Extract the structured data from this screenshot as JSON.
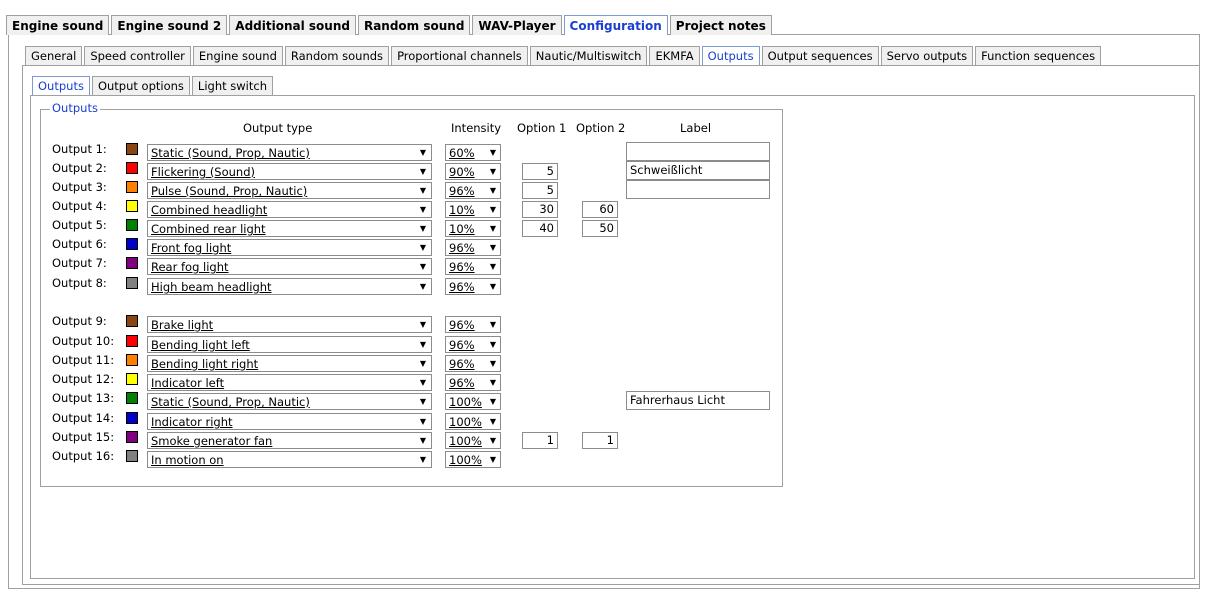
{
  "main_tabs": [
    {
      "label": "Engine sound",
      "active": false
    },
    {
      "label": "Engine sound 2",
      "active": false
    },
    {
      "label": "Additional sound",
      "active": false
    },
    {
      "label": "Random sound",
      "active": false
    },
    {
      "label": "WAV-Player",
      "active": false
    },
    {
      "label": "Configuration",
      "active": true
    },
    {
      "label": "Project notes",
      "active": false
    }
  ],
  "sub_tabs": [
    {
      "label": "General",
      "active": false
    },
    {
      "label": "Speed controller",
      "active": false
    },
    {
      "label": "Engine sound",
      "active": false
    },
    {
      "label": "Random sounds",
      "active": false
    },
    {
      "label": "Proportional channels",
      "active": false
    },
    {
      "label": "Nautic/Multiswitch",
      "active": false
    },
    {
      "label": "EKMFA",
      "active": false
    },
    {
      "label": "Outputs",
      "active": true
    },
    {
      "label": "Output sequences",
      "active": false
    },
    {
      "label": "Servo outputs",
      "active": false
    },
    {
      "label": "Function sequences",
      "active": false
    }
  ],
  "output_tabs": [
    {
      "label": "Outputs",
      "active": true
    },
    {
      "label": "Output options",
      "active": false
    },
    {
      "label": "Light switch",
      "active": false
    }
  ],
  "group_title": "Outputs",
  "headers": {
    "type": "Output type",
    "intensity": "Intensity",
    "option1": "Option 1",
    "option2": "Option 2",
    "label": "Label"
  },
  "arrow_glyph": "▼",
  "outputs": [
    {
      "name": "Output 1:",
      "color": "#8B4513",
      "type": "Static (Sound, Prop, Nautic)",
      "intensity": "60%",
      "opt1": "",
      "opt2": "",
      "label": "",
      "show_label": true
    },
    {
      "name": "Output 2:",
      "color": "#FF0000",
      "type": "Flickering (Sound)",
      "intensity": "90%",
      "opt1": "5",
      "opt2": "",
      "label": "Schweißlicht",
      "show_label": true
    },
    {
      "name": "Output 3:",
      "color": "#FF8000",
      "type": "Pulse (Sound, Prop, Nautic)",
      "intensity": "96%",
      "opt1": "5",
      "opt2": "",
      "label": "",
      "show_label": true
    },
    {
      "name": "Output 4:",
      "color": "#FFFF00",
      "type": "Combined headlight",
      "intensity": "10%",
      "opt1": "30",
      "opt2": "60",
      "label": "",
      "show_label": false
    },
    {
      "name": "Output 5:",
      "color": "#008000",
      "type": "Combined rear light",
      "intensity": "10%",
      "opt1": "40",
      "opt2": "50",
      "label": "",
      "show_label": false
    },
    {
      "name": "Output 6:",
      "color": "#0000CC",
      "type": "Front fog light",
      "intensity": "96%",
      "opt1": "",
      "opt2": "",
      "label": "",
      "show_label": false
    },
    {
      "name": "Output 7:",
      "color": "#800080",
      "type": "Rear fog light",
      "intensity": "96%",
      "opt1": "",
      "opt2": "",
      "label": "",
      "show_label": false
    },
    {
      "name": "Output 8:",
      "color": "#808080",
      "type": "High beam headlight",
      "intensity": "96%",
      "opt1": "",
      "opt2": "",
      "label": "",
      "show_label": false
    },
    {
      "name": "Output 9:",
      "color": "#8B4513",
      "type": "Brake light",
      "intensity": "96%",
      "opt1": "",
      "opt2": "",
      "label": "",
      "show_label": false
    },
    {
      "name": "Output 10:",
      "color": "#FF0000",
      "type": "Bending light left",
      "intensity": "96%",
      "opt1": "",
      "opt2": "",
      "label": "",
      "show_label": false
    },
    {
      "name": "Output 11:",
      "color": "#FF8000",
      "type": "Bending light right",
      "intensity": "96%",
      "opt1": "",
      "opt2": "",
      "label": "",
      "show_label": false
    },
    {
      "name": "Output 12:",
      "color": "#FFFF00",
      "type": "Indicator left",
      "intensity": "96%",
      "opt1": "",
      "opt2": "",
      "label": "",
      "show_label": false
    },
    {
      "name": "Output 13:",
      "color": "#008000",
      "type": "Static (Sound, Prop, Nautic)",
      "intensity": "100%",
      "opt1": "",
      "opt2": "",
      "label": "Fahrerhaus Licht",
      "show_label": true
    },
    {
      "name": "Output 14:",
      "color": "#0000CC",
      "type": "Indicator right",
      "intensity": "100%",
      "opt1": "",
      "opt2": "",
      "label": "",
      "show_label": false
    },
    {
      "name": "Output 15:",
      "color": "#800080",
      "type": "Smoke generator fan",
      "intensity": "100%",
      "opt1": "1",
      "opt2": "1",
      "label": "",
      "show_label": false
    },
    {
      "name": "Output 16:",
      "color": "#808080",
      "type": "In motion on",
      "intensity": "100%",
      "opt1": "",
      "opt2": "",
      "label": "",
      "show_label": false
    }
  ]
}
